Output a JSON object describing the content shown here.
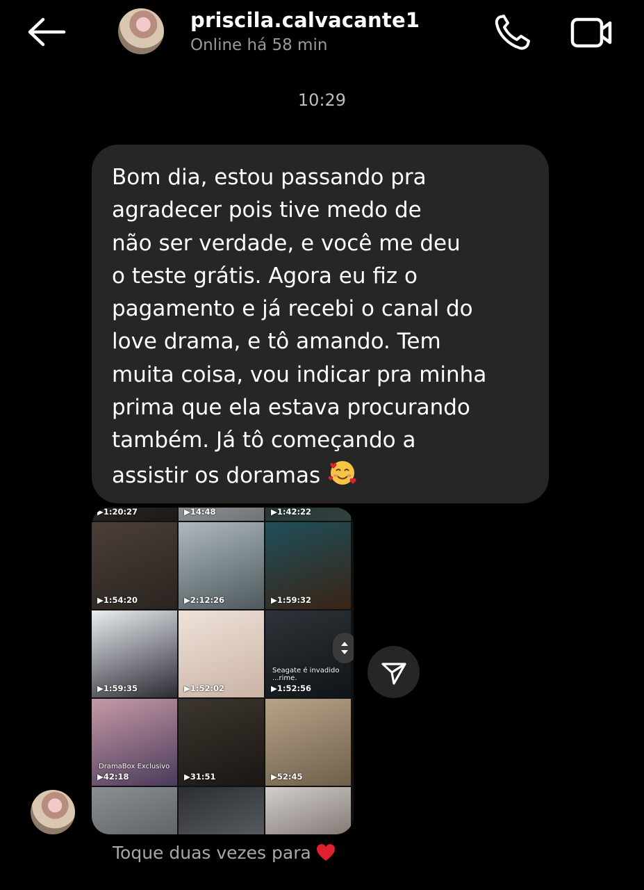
{
  "header": {
    "username": "priscila.calvacante1",
    "status": "Online há 58 min",
    "icons": {
      "back": "arrow-left-icon",
      "call": "phone-icon",
      "video": "video-camera-icon"
    }
  },
  "chat": {
    "timestamp": "10:29",
    "message": "Bom dia, estou passando pra\nagradecer pois tive medo de\nnão ser verdade, e você me deu\no teste grátis. Agora eu fiz o\npagamento e já recebi o canal do\nlove drama, e tô amando. Tem\nmuita coisa, vou indicar pra minha\nprima que ela estava procurando\ntambém. Já tô começando a\nassistir os doramas",
    "message_emoji": "smiling-face-with-hearts",
    "double_tap_hint": "Toque duas vezes para",
    "hint_emoji": "red-heart"
  },
  "media": {
    "tiles": [
      {
        "duration": "1:20:27",
        "colors": [
          "#3b3534",
          "#1e1a18"
        ]
      },
      {
        "duration": "14:48",
        "colors": [
          "#b9bcc0",
          "#6f7479"
        ]
      },
      {
        "duration": "1:42:22",
        "colors": [
          "#0f2630",
          "#31423e"
        ]
      },
      {
        "duration": "1:54:20",
        "colors": [
          "#4b3f38",
          "#2a2420"
        ]
      },
      {
        "duration": "2:12:26",
        "colors": [
          "#aeb8bd",
          "#4e5a5e"
        ]
      },
      {
        "duration": "1:59:32",
        "colors": [
          "#1f4f5b",
          "#3a2314"
        ]
      },
      {
        "duration": "1:59:35",
        "colors": [
          "#e9eef2",
          "#2b2b33"
        ]
      },
      {
        "duration": "1:52:02",
        "colors": [
          "#efe2d8",
          "#c9b3a4"
        ]
      },
      {
        "duration": "1:52:56",
        "caption": "Seagate é invadido ...rime.",
        "colors": [
          "#2d3338",
          "#101418"
        ]
      },
      {
        "duration": "42:18",
        "caption": "DramaBox Exclusivo",
        "colors": [
          "#c69aa7",
          "#4a3a5a"
        ]
      },
      {
        "duration": "31:51",
        "colors": [
          "#3d3630",
          "#1a1612"
        ]
      },
      {
        "duration": "52:45",
        "colors": [
          "#b7a38a",
          "#6e6049"
        ]
      },
      {
        "duration": "",
        "colors": [
          "#8a8f93",
          "#4a4f53"
        ]
      },
      {
        "duration": "",
        "colors": [
          "#2b2f33",
          "#6c6f72"
        ]
      },
      {
        "duration": "",
        "colors": [
          "#d3cfcc",
          "#5b4f4a"
        ]
      }
    ]
  },
  "colors": {
    "background": "#000000",
    "bubble": "#262626",
    "muted_text": "#9a9a9a",
    "heart": "#e0202e"
  }
}
